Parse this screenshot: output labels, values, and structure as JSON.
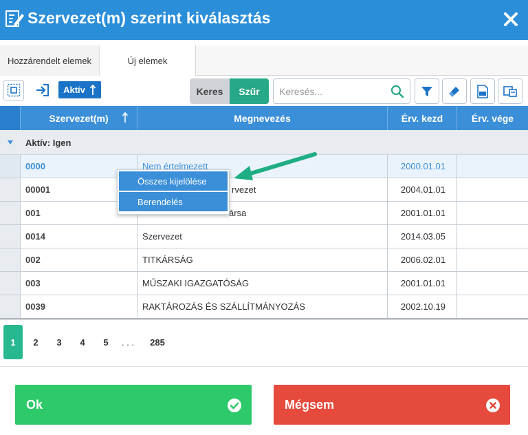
{
  "dialog": {
    "title": "Szervezet(m) szerint kiválasztás"
  },
  "tabs": [
    {
      "label": "Hozzárendelt elemek"
    },
    {
      "label": "Új elemek"
    }
  ],
  "toolbar": {
    "aktiv_label": "Aktív",
    "keres_label": "Keres",
    "szur_label": "Szűr",
    "search_placeholder": "Keresés...",
    "search_value": ""
  },
  "grid": {
    "columns": [
      "Szervezet(m)",
      "Megnevezés",
      "Érv. kezd",
      "Érv. vége"
    ],
    "group_label": "Aktív: Igen",
    "rows": [
      {
        "code": "0000",
        "name": "Nem értelmezett",
        "start": "2000.01.01",
        "end": ""
      },
      {
        "code": "00001",
        "name": "Szervezet",
        "start": "2004.01.01",
        "end": ""
      },
      {
        "code": "001",
        "name": "Vezérigazgató munkatársa",
        "start": "2001.01.01",
        "end": ""
      },
      {
        "code": "0014",
        "name": "Szervezet",
        "start": "2014.03.05",
        "end": ""
      },
      {
        "code": "002",
        "name": "TITKÁRSÁG",
        "start": "2006.02.01",
        "end": ""
      },
      {
        "code": "003",
        "name": "MŰSZAKI IGAZGATÓSÁG",
        "start": "2001.01.01",
        "end": ""
      },
      {
        "code": "0039",
        "name": "RAKTÁROZÁS ÉS SZÁLLÍTMÁNYOZÁS",
        "start": "2002.10.19",
        "end": ""
      }
    ],
    "visible_name_fragments": [
      "Nem értelmezett",
      "rvezet",
      "ársa",
      "Szervezet",
      "TITKÁRSÁG",
      "MŰSZAKI IGAZGATÓSÁG",
      "RAKTÁROZÁS ÉS SZÁLLÍTMÁNYOZÁS"
    ]
  },
  "context_menu": {
    "items": [
      "Összes kijelölése",
      "Berendelés"
    ]
  },
  "pager": {
    "pages": [
      "1",
      "2",
      "3",
      "4",
      "5",
      ". . .",
      "285"
    ],
    "active": "1"
  },
  "buttons": {
    "ok_label": "Ok",
    "cancel_label": "Mégsem"
  },
  "colors": {
    "title_bar": "#2b8ed9",
    "header": "#3a8fd8",
    "accent_green": "#27b890",
    "ok": "#2ec96b",
    "cancel": "#e64a3c"
  }
}
